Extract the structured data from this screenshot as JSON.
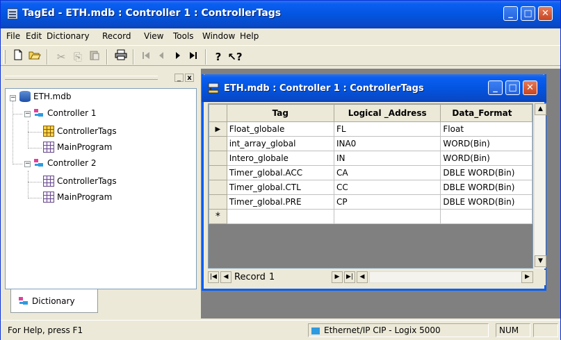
{
  "window": {
    "title": "TagEd - ETH.mdb : Controller 1 : ControllerTags",
    "minimize": "_",
    "maximize": "□",
    "close": "✕"
  },
  "menu": [
    "File",
    "Edit",
    "Dictionary",
    "Record",
    "View",
    "Tools",
    "Window",
    "Help"
  ],
  "toolbar": {
    "icons": [
      "new-icon",
      "open-icon",
      "cut-icon",
      "copy-icon",
      "paste-icon",
      "print-icon",
      "first-record-icon",
      "prev-record-icon",
      "next-record-icon",
      "last-record-icon",
      "help-icon",
      "context-help-icon"
    ]
  },
  "dictionary_pane": {
    "minimize": "_",
    "close": "x",
    "tree": {
      "root": "ETH.mdb",
      "controllers": [
        {
          "name": "Controller 1",
          "children": [
            "ControllerTags",
            "MainProgram"
          ]
        },
        {
          "name": "Controller 2",
          "children": [
            "ControllerTags",
            "MainProgram"
          ]
        }
      ]
    },
    "tab": "Dictionary"
  },
  "child_window": {
    "title": "ETH.mdb : Controller 1 : ControllerTags",
    "columns": [
      "Tag",
      "Logical _Address",
      "Data_Format"
    ],
    "rows": [
      {
        "tag": "Float_globale",
        "address": "FL",
        "format": "Float"
      },
      {
        "tag": "int_array_global",
        "address": "INA0",
        "format": "WORD(Bin)"
      },
      {
        "tag": "Intero_globale",
        "address": "IN",
        "format": "WORD(Bin)"
      },
      {
        "tag": "Timer_global.ACC",
        "address": "CA",
        "format": "DBLE WORD(Bin)"
      },
      {
        "tag": "Timer_global.CTL",
        "address": "CC",
        "format": "DBLE WORD(Bin)"
      },
      {
        "tag": "Timer_global.PRE",
        "address": "CP",
        "format": "DBLE WORD(Bin)"
      }
    ],
    "current_row_marker": "▶",
    "new_row_marker": "*",
    "navigation": {
      "label": "Record",
      "value": "1"
    }
  },
  "statusbar": {
    "help": "For Help, press F1",
    "driver": "Ethernet/IP CIP - Logix 5000",
    "num": "NUM"
  }
}
